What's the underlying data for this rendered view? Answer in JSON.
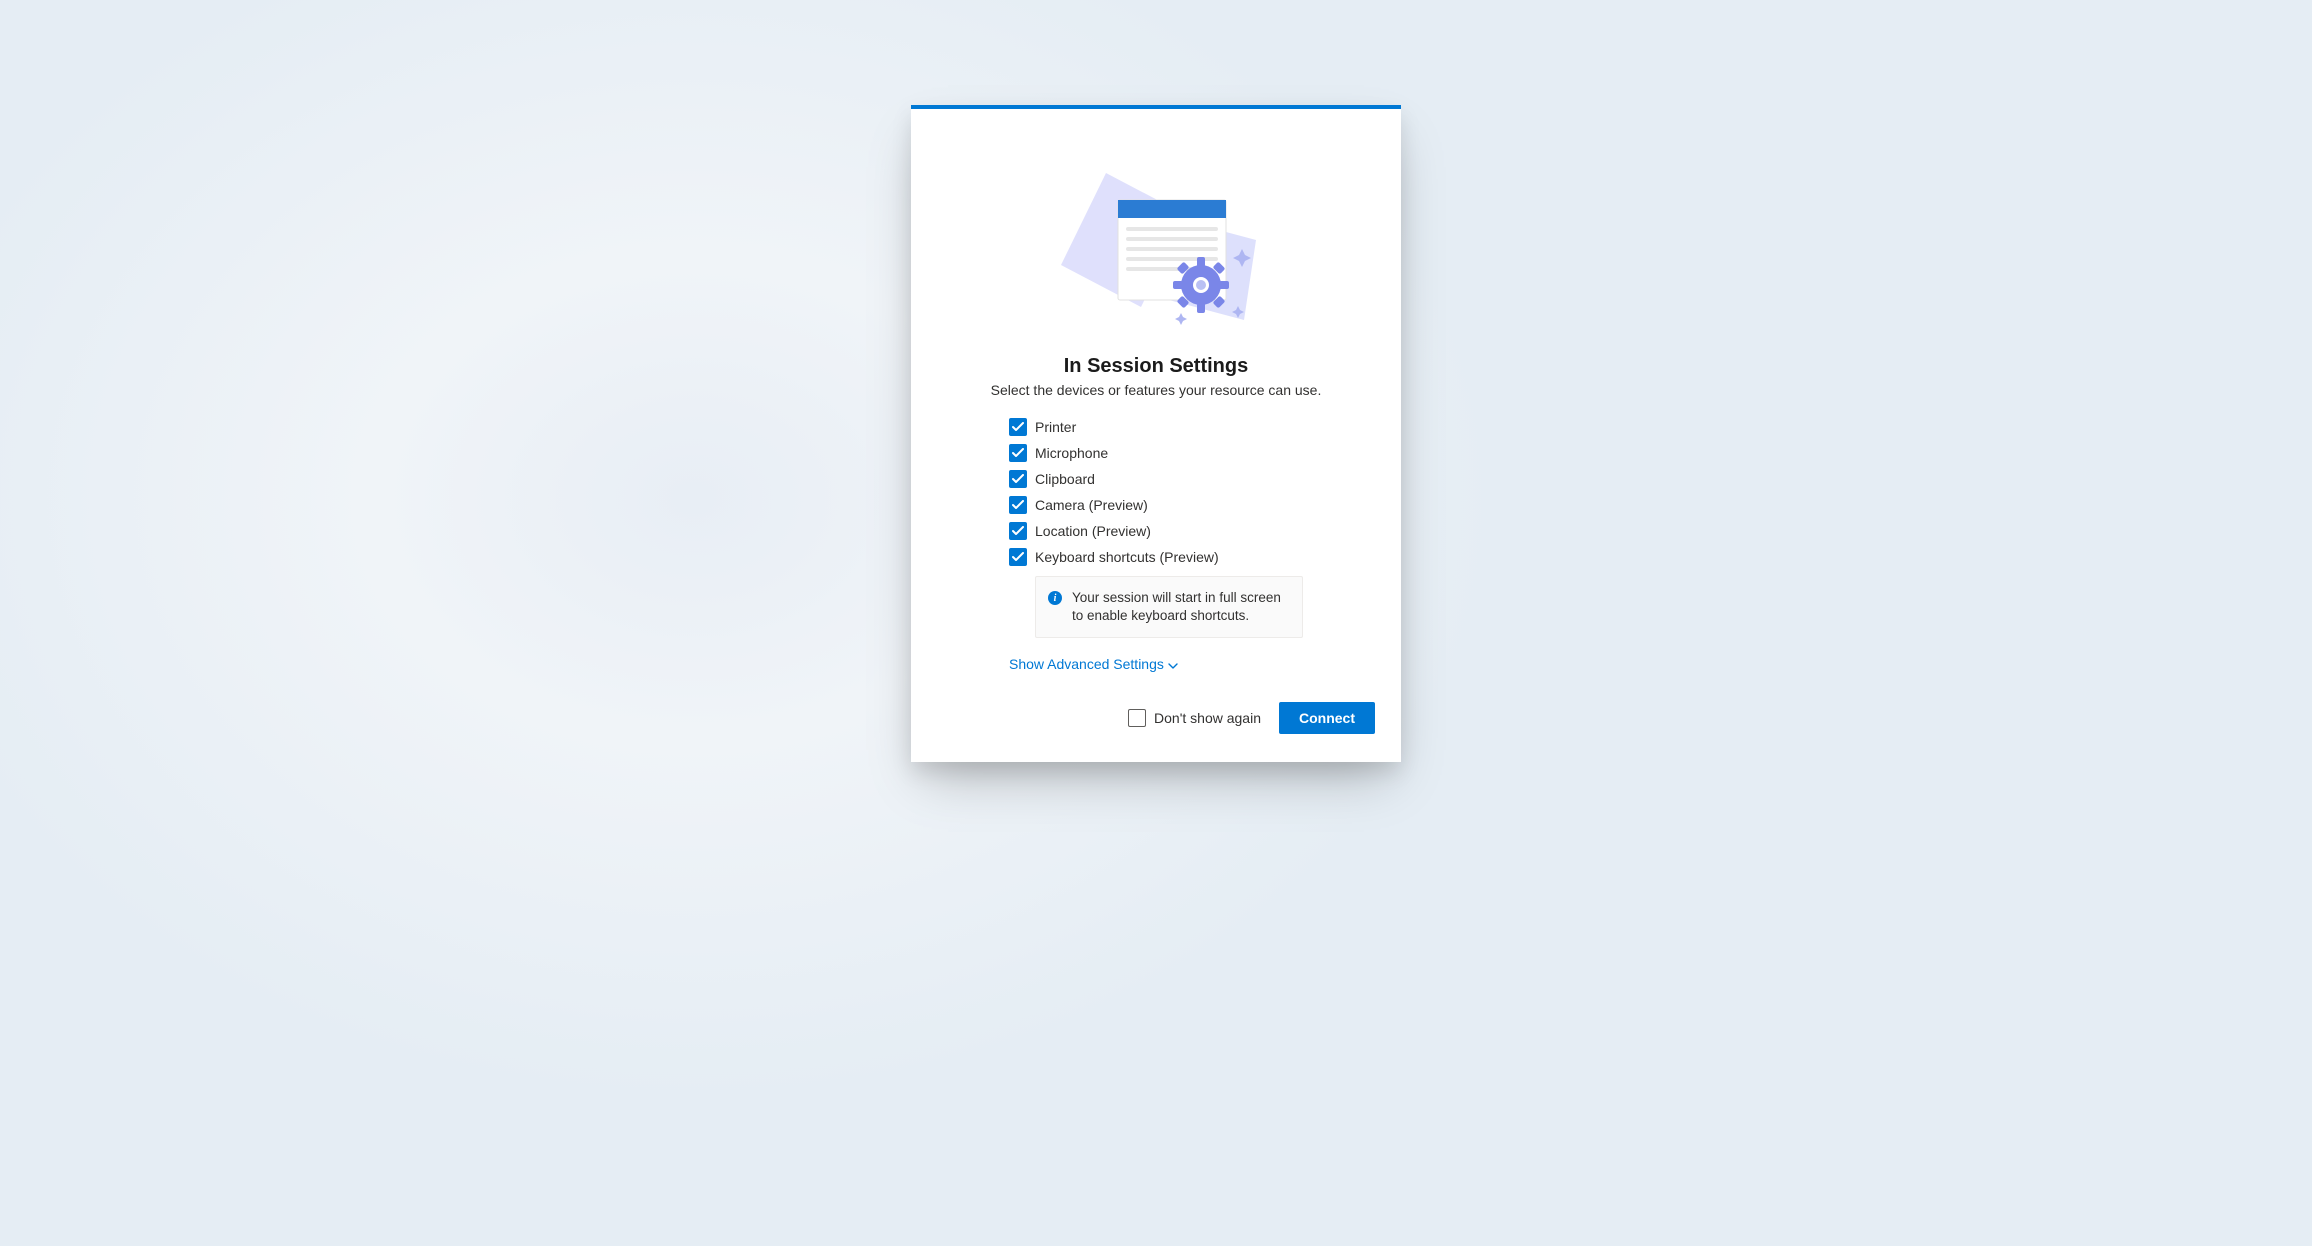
{
  "dialog": {
    "title": "In Session Settings",
    "subtitle": "Select the devices or features your resource can use.",
    "options": [
      {
        "label": "Printer",
        "checked": true
      },
      {
        "label": "Microphone",
        "checked": true
      },
      {
        "label": "Clipboard",
        "checked": true
      },
      {
        "label": "Camera (Preview)",
        "checked": true
      },
      {
        "label": "Location (Preview)",
        "checked": true
      },
      {
        "label": "Keyboard shortcuts (Preview)",
        "checked": true
      }
    ],
    "info_message": "Your session will start in full screen to enable keyboard shortcuts.",
    "advanced_link": "Show Advanced Settings",
    "dont_show_label": "Don't show again",
    "dont_show_checked": false,
    "connect_label": "Connect"
  }
}
